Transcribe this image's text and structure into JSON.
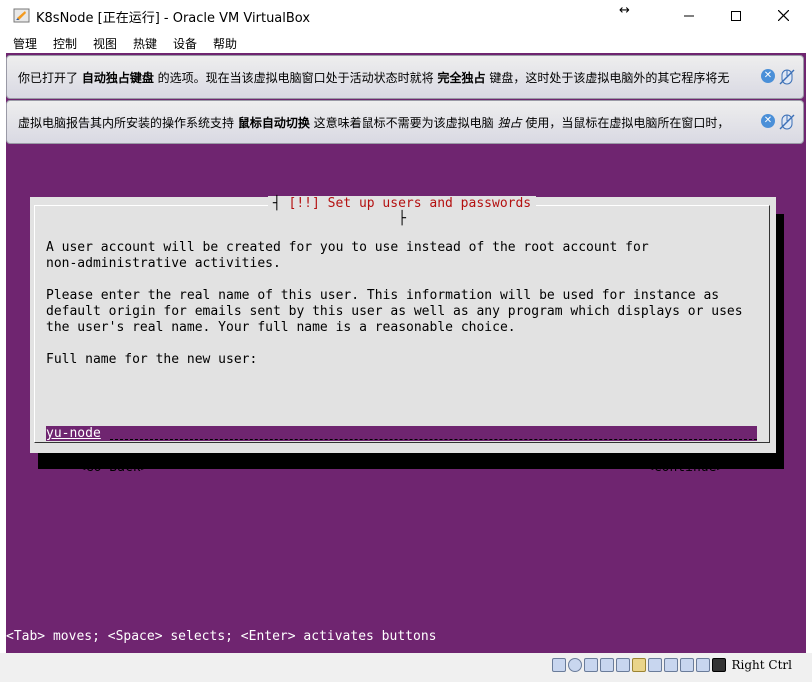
{
  "window": {
    "title": "K8sNode [正在运行] - Oracle VM VirtualBox",
    "resize_glyph": "↔",
    "controls": {
      "minimize": "─",
      "maximize": "☐",
      "close": "✕"
    }
  },
  "menu": [
    "管理",
    "控制",
    "视图",
    "热键",
    "设备",
    "帮助"
  ],
  "notices": [
    {
      "text_a": "你已打开了 ",
      "bold_a": "自动独占键盘",
      "text_b": " 的选项。现在当该虚拟电脑窗口处于活动状态时就将 ",
      "bold_b": "完全独占",
      "text_c": " 键盘，这时处于该虚拟电脑外的其它程序将无"
    },
    {
      "text_a": "虚拟电脑报告其内所安装的操作系统支持 ",
      "bold_a": "鼠标自动切换",
      "text_b": "  这意味着鼠标不需要为该虚拟电脑 ",
      "italic_b": "独占",
      "text_c": " 使用，当鼠标在虚拟电脑所在窗口时，"
    }
  ],
  "dialog": {
    "title": "[!!] Set up users and passwords",
    "para1": "A user account will be created for you to use instead of the root account for\nnon-administrative activities.",
    "para2": "Please enter the real name of this user. This information will be used for instance as\ndefault origin for emails sent by this user as well as any program which displays or uses\nthe user's real name. Your full name is a reasonable choice.",
    "field_label": "Full name for the new user:",
    "field_value": "yu-node",
    "back_button": "<Go Back>",
    "continue_button": "<Continue>"
  },
  "hint": "<Tab> moves; <Space> selects; <Enter> activates buttons",
  "status": {
    "host_key": "Right Ctrl",
    "tray_icons": [
      "hdd-icon",
      "optical-disc-icon",
      "audio-icon",
      "network-icon",
      "usb-icon",
      "shared-folder-icon",
      "display-icon",
      "recording-icon",
      "cpu-icon",
      "mouse-integration-icon",
      "keyboard-icon"
    ]
  },
  "colors": {
    "vm_background": "#6f2570",
    "dialog_title": "#b41010",
    "dialog_bg": "#e2e2e2"
  }
}
